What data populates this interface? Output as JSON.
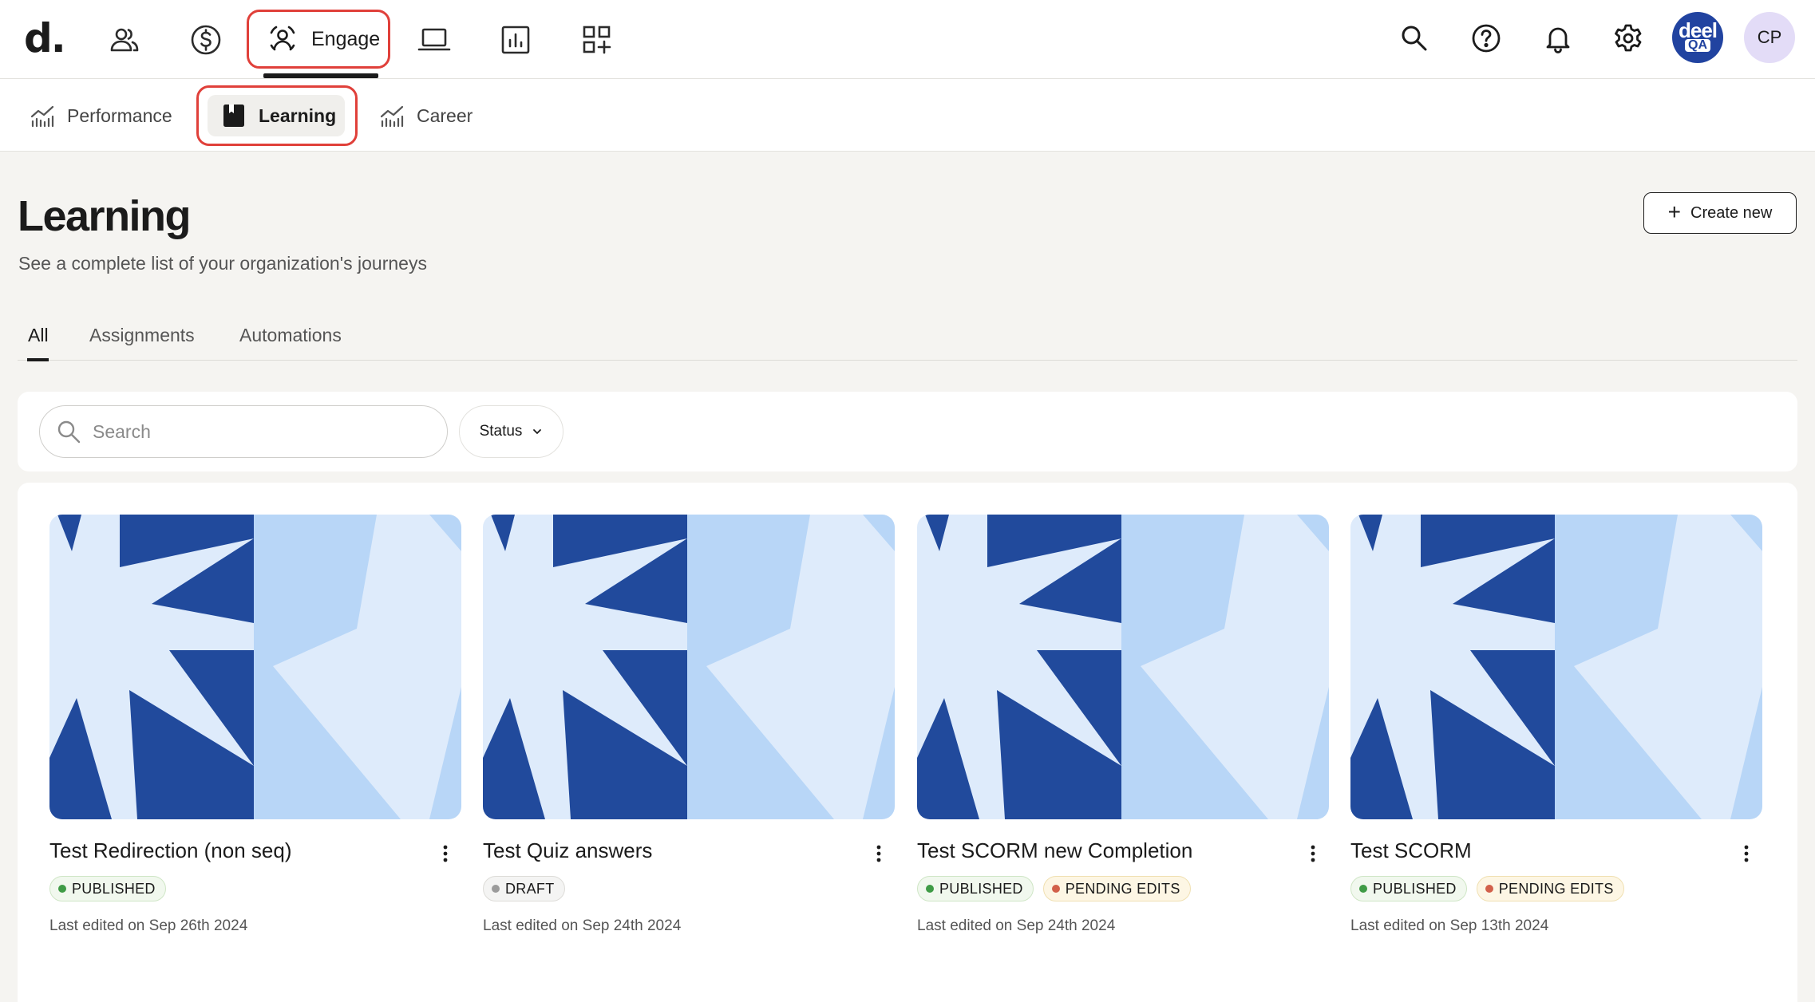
{
  "topbar": {
    "logo": "d.",
    "nav_icons": [
      "people-icon",
      "dollar-icon",
      "engage-icon",
      "laptop-icon",
      "report-icon",
      "apps-add-icon"
    ],
    "engage_label": "Engage",
    "right_icons": [
      "search-icon",
      "help-icon",
      "bell-icon",
      "gear-icon"
    ],
    "org_avatar": {
      "line1": "deel",
      "line2": "QA"
    },
    "user_initials": "CP"
  },
  "subnav": {
    "performance": "Performance",
    "learning": "Learning",
    "career": "Career"
  },
  "page": {
    "title": "Learning",
    "subtitle": "See a complete list of your organization's journeys",
    "create_button": "Create new"
  },
  "tabs": [
    "All",
    "Assignments",
    "Automations"
  ],
  "filters": {
    "search_placeholder": "Search",
    "status_label": "Status"
  },
  "colors": {
    "thumb_dark": "#214a9c",
    "thumb_mid": "#b8d6f7",
    "thumb_light": "#deebfb",
    "highlight": "#e0403a"
  },
  "cards": [
    {
      "title": "Test Redirection (non seq)",
      "badges": [
        {
          "label": "PUBLISHED",
          "kind": "published"
        }
      ],
      "edited": "Last edited on Sep 26th 2024"
    },
    {
      "title": "Test Quiz answers",
      "badges": [
        {
          "label": "DRAFT",
          "kind": "draft"
        }
      ],
      "edited": "Last edited on Sep 24th 2024"
    },
    {
      "title": "Test SCORM new Completion",
      "badges": [
        {
          "label": "PUBLISHED",
          "kind": "published"
        },
        {
          "label": "PENDING EDITS",
          "kind": "pending"
        }
      ],
      "edited": "Last edited on Sep 24th 2024"
    },
    {
      "title": "Test SCORM",
      "badges": [
        {
          "label": "PUBLISHED",
          "kind": "published"
        },
        {
          "label": "PENDING EDITS",
          "kind": "pending"
        }
      ],
      "edited": "Last edited on Sep 13th 2024"
    }
  ]
}
